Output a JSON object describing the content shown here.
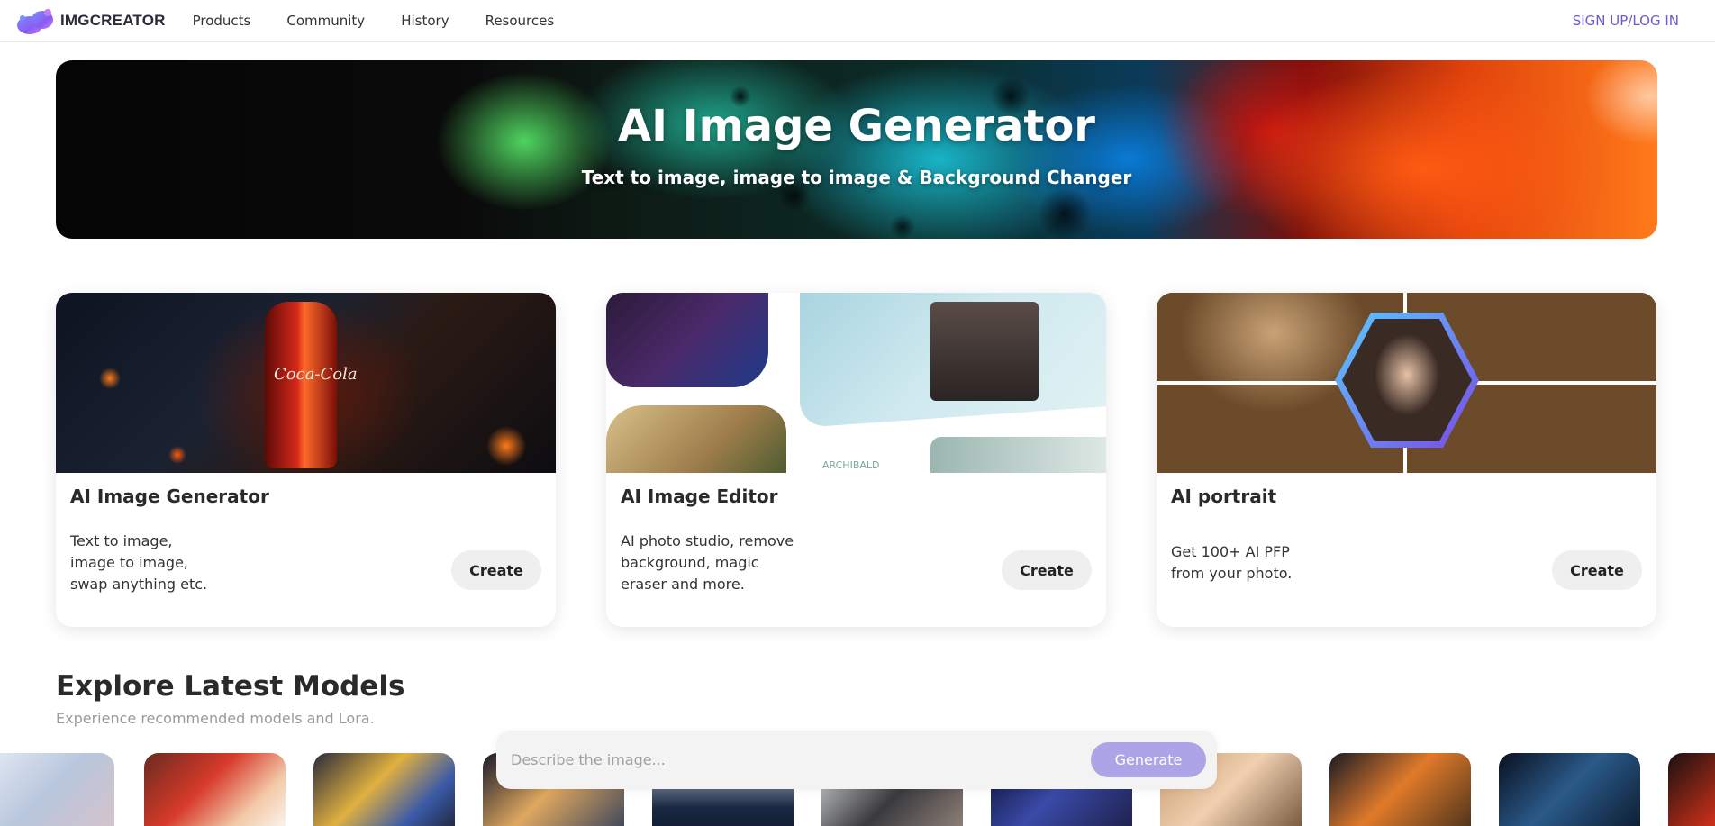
{
  "nav": {
    "logo_text": "IMGCREATOR",
    "links": [
      "Products",
      "Community",
      "History",
      "Resources"
    ],
    "auth": "SIGN UP/LOG IN"
  },
  "hero": {
    "title": "AI Image Generator",
    "subtitle": "Text to image, image to image & Background Changer"
  },
  "cards": [
    {
      "title": "AI Image Generator",
      "desc": "Text to image,\nimage to image,\nswap anything etc.",
      "button": "Create",
      "image_text": "Coca-Cola"
    },
    {
      "title": "AI Image Editor",
      "desc": "AI photo studio, remove\nbackground, magic\neraser and more.",
      "button": "Create",
      "image_text": "ARCHIBALD"
    },
    {
      "title": "AI portrait",
      "desc": "Get 100+ AI PFP\nfrom your photo.",
      "button": "Create"
    }
  ],
  "explore": {
    "title": "Explore Latest Models",
    "subtitle": "Experience recommended models and Lora."
  },
  "prompt": {
    "placeholder": "Describe the image...",
    "value": "",
    "button": "Generate"
  },
  "colors": {
    "accent": "#6a5bd6",
    "generate_button": "#ada4e8"
  }
}
